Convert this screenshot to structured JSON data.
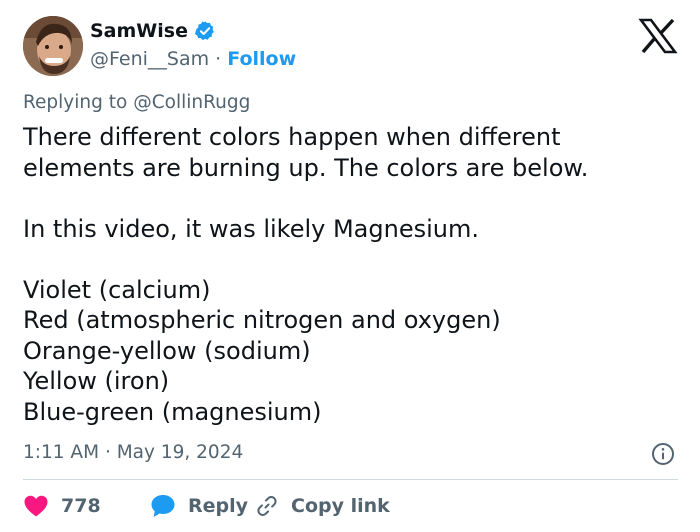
{
  "author": {
    "display_name": "SamWise",
    "handle": "@Feni__Sam",
    "separator": "·",
    "follow_label": "Follow",
    "verified_color": "#1d9bf0"
  },
  "reply_context": {
    "prefix": "Replying to",
    "mention": "@CollinRugg"
  },
  "tweet": {
    "lines": [
      "There different colors happen when different",
      "elements are burning up. The colors are below.",
      "",
      "In this video, it was likely Magnesium.",
      "",
      "Violet (calcium)",
      "Red (atmospheric nitrogen and oxygen)",
      "Orange-yellow (sodium)",
      "Yellow (iron)",
      "Blue-green (magnesium)"
    ],
    "time": "1:11 AM",
    "date_separator": "·",
    "date": "May 19, 2024"
  },
  "actions": {
    "like_count": "778",
    "reply_label": "Reply",
    "copy_label": "Copy link",
    "like_color": "#f91880",
    "reply_color": "#1d9bf0"
  },
  "icons": [
    "verified-badge-icon",
    "x-logo-icon",
    "info-icon",
    "heart-icon",
    "reply-bubble-icon",
    "link-icon"
  ]
}
